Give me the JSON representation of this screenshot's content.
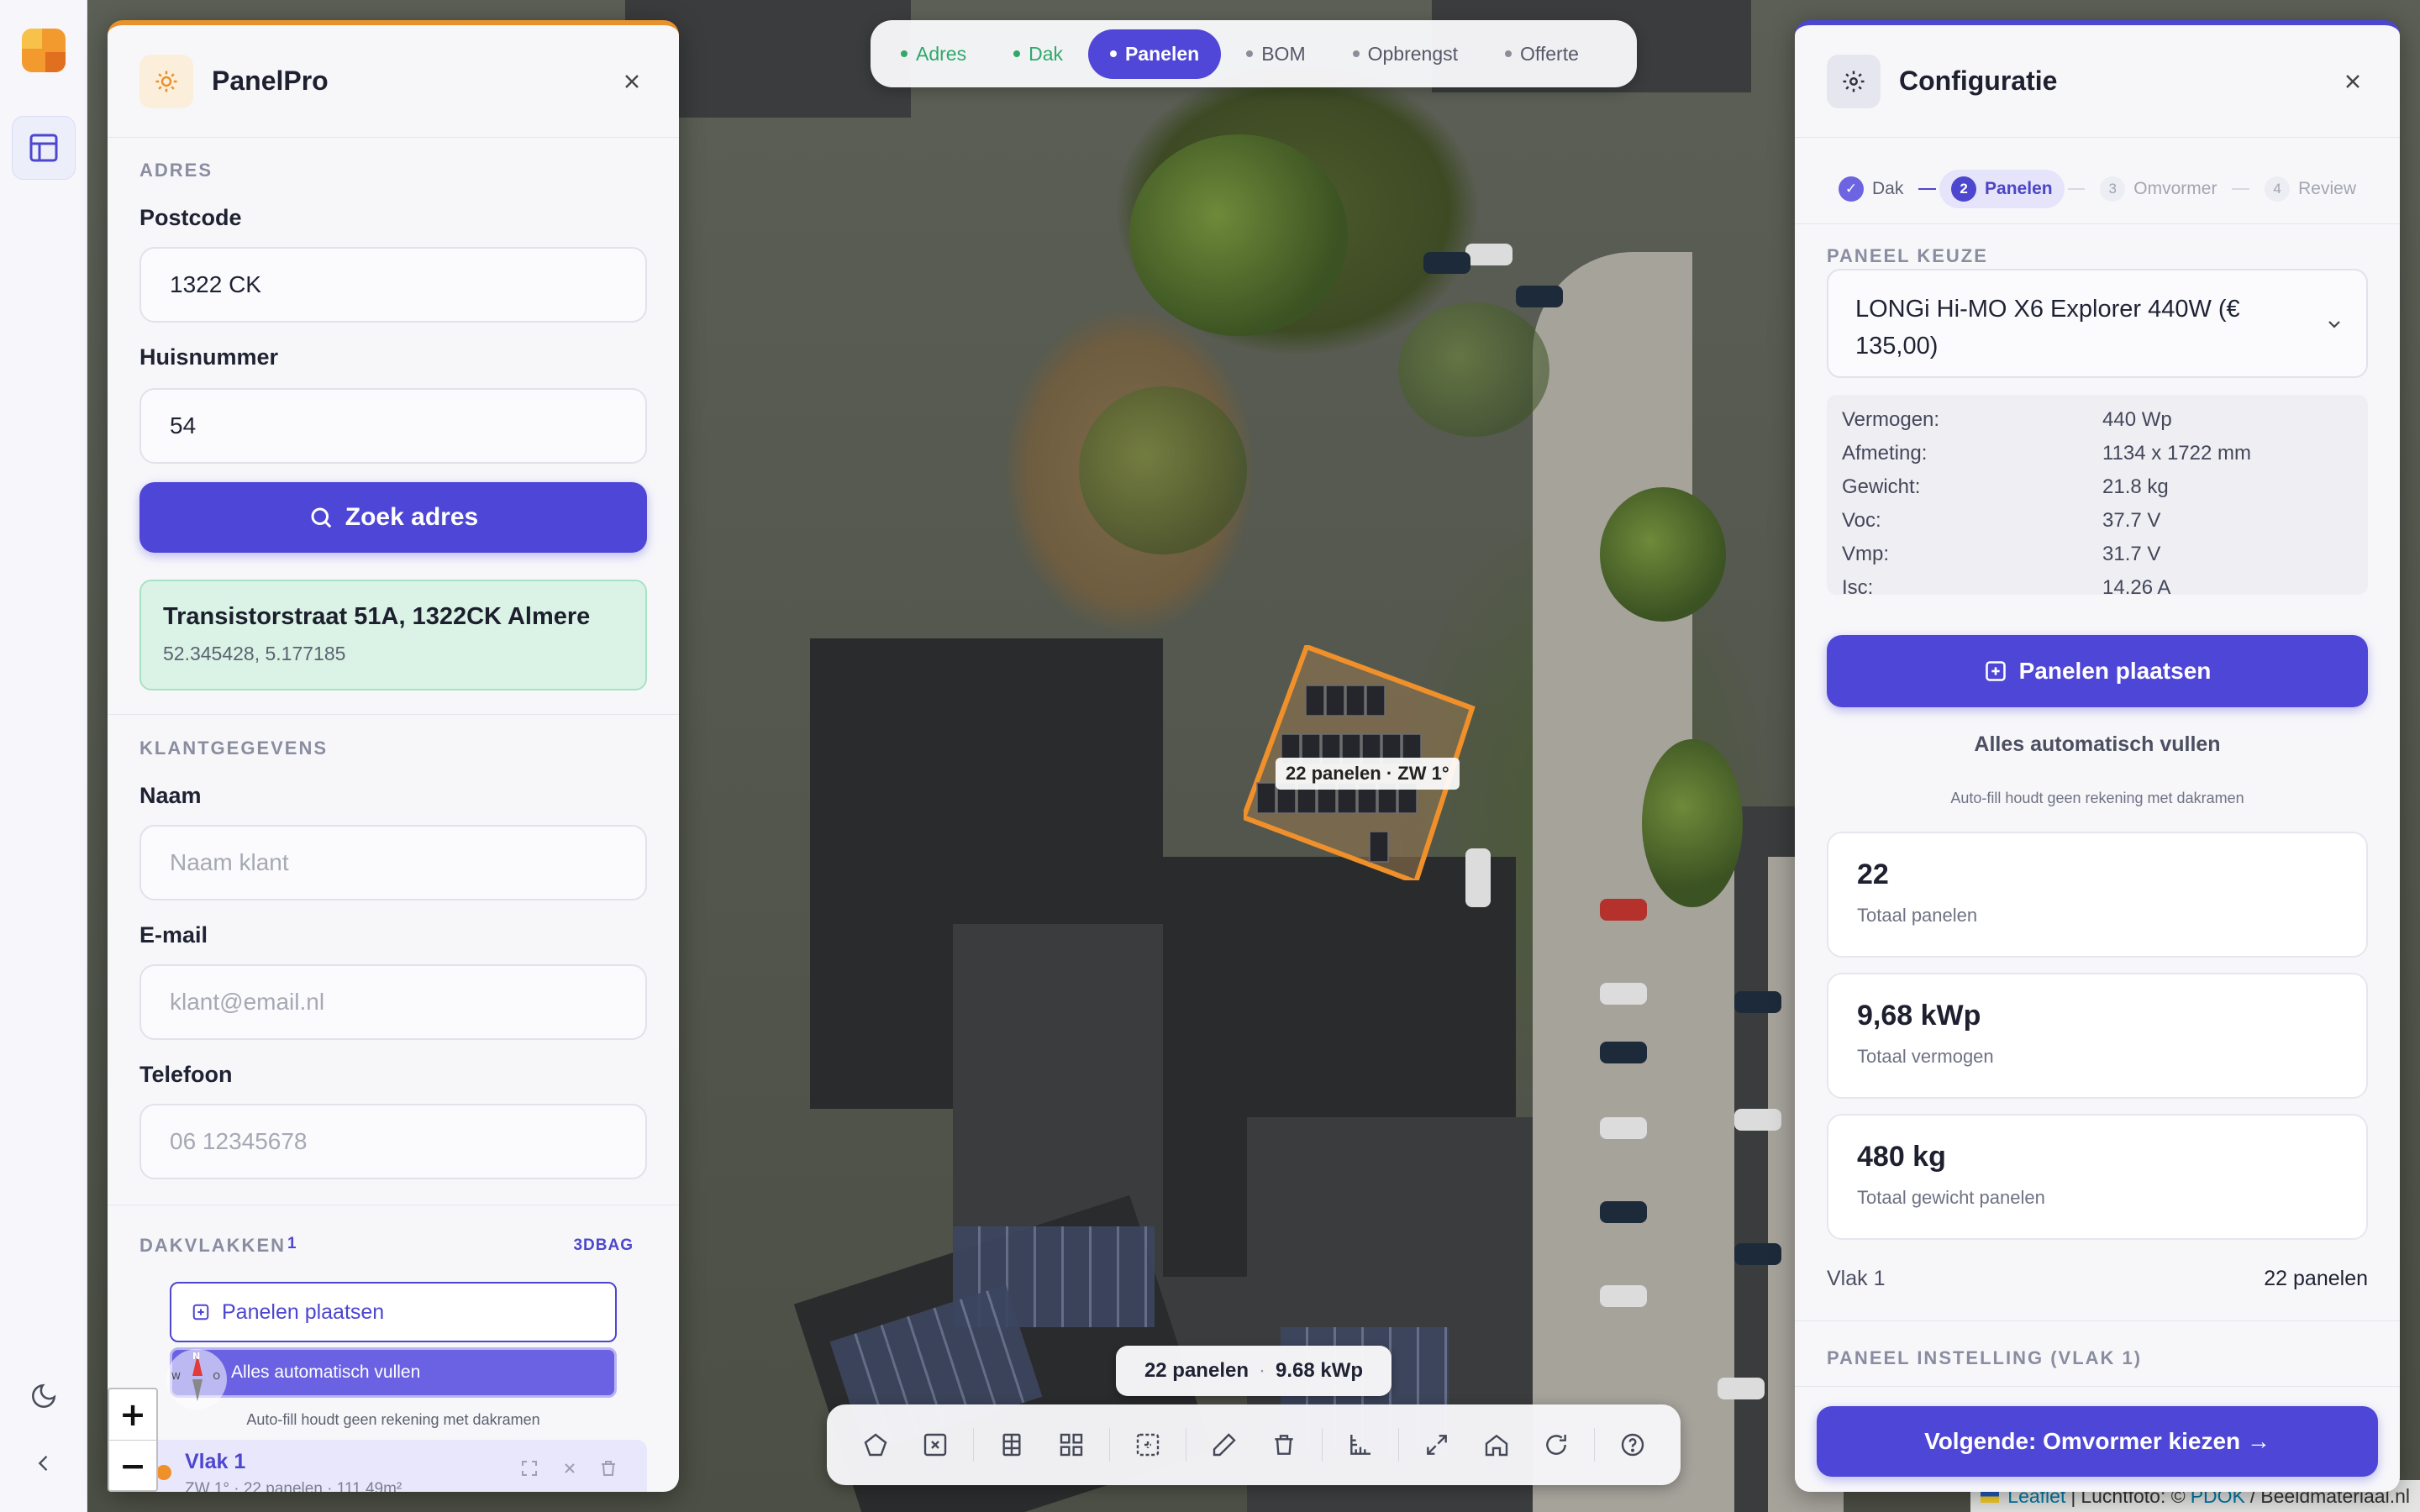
{
  "top_steps": [
    {
      "label": "Adres",
      "state": "done"
    },
    {
      "label": "Dak",
      "state": "done"
    },
    {
      "label": "Panelen",
      "state": "active"
    },
    {
      "label": "BOM",
      "state": "todo"
    },
    {
      "label": "Opbrengst",
      "state": "todo"
    },
    {
      "label": "Offerte",
      "state": "todo"
    }
  ],
  "left_panel": {
    "title": "PanelPro",
    "address_section": "ADRES",
    "postcode_label": "Postcode",
    "postcode_value": "1322 CK",
    "house_label": "Huisnummer",
    "house_value": "54",
    "search_button": "Zoek adres",
    "result_address": "Transistorstraat 51A, 1322CK Almere",
    "result_coords": "52.345428, 5.177185",
    "customer_section": "KLANTGEGEVENS",
    "name_label": "Naam",
    "name_placeholder": "Naam klant",
    "email_label": "E-mail",
    "email_placeholder": "klant@email.nl",
    "phone_label": "Telefoon",
    "phone_placeholder": "06 12345678",
    "roofs_section": "DAKVLAKKEN",
    "roofs_count": "1",
    "roofs_source": "3DBAG",
    "place_panels": "Panelen plaatsen",
    "autofill": "Alles automatisch vullen",
    "autofill_note": "Auto-fill houdt geen rekening met dakramen",
    "plane_name": "Vlak 1",
    "plane_meta": "ZW 1° · 22 panelen · 111.49m²"
  },
  "map": {
    "plane_label": "22 panelen · ZW 1°",
    "status_panels": "22 panelen",
    "status_sep": "·",
    "status_power": "9.68 kWp",
    "zoom_in": "+",
    "zoom_out": "−",
    "compass_n": "N",
    "compass_w": "W",
    "compass_e": "O",
    "attribution": {
      "leaflet": "Leaflet",
      "sep": "|",
      "luchtfoto": "Luchtfoto: ©",
      "pdok": "PDOK",
      "slash": "/",
      "beeld": "Beeldmateriaal.nl"
    }
  },
  "right_panel": {
    "title": "Configuratie",
    "wizard": [
      {
        "num": "✓",
        "label": "Dak",
        "state": "done"
      },
      {
        "num": "2",
        "label": "Panelen",
        "state": "active"
      },
      {
        "num": "3",
        "label": "Omvormer",
        "state": "todo"
      },
      {
        "num": "4",
        "label": "Review",
        "state": "todo"
      }
    ],
    "panel_section": "PANEEL KEUZE",
    "panel_select": "LONGi Hi-MO X6 Explorer 440W (€ 135,00)",
    "specs": [
      {
        "k": "Vermogen:",
        "v": "440 Wp"
      },
      {
        "k": "Afmeting:",
        "v": "1134 x 1722 mm"
      },
      {
        "k": "Gewicht:",
        "v": "21.8 kg"
      },
      {
        "k": "Voc:",
        "v": "37.7 V"
      },
      {
        "k": "Vmp:",
        "v": "31.7 V"
      },
      {
        "k": "Isc:",
        "v": "14.26 A"
      }
    ],
    "place_button": "Panelen plaatsen",
    "autofill": "Alles automatisch vullen",
    "autofill_note": "Auto-fill houdt geen rekening met dakramen",
    "stats": [
      {
        "big": "22",
        "small": "Totaal panelen"
      },
      {
        "big": "9,68 kWp",
        "small": "Totaal vermogen"
      },
      {
        "big": "480 kg",
        "small": "Totaal gewicht panelen"
      }
    ],
    "plane_name": "Vlak 1",
    "plane_count": "22 panelen",
    "settings_section": "PANEEL INSTELLING (VLAK 1)",
    "next_button": "Volgende: Omvormer kiezen →"
  },
  "colors": {
    "accent": "#4e46d6",
    "success": "#2fa86c",
    "orange": "#f0902a"
  }
}
